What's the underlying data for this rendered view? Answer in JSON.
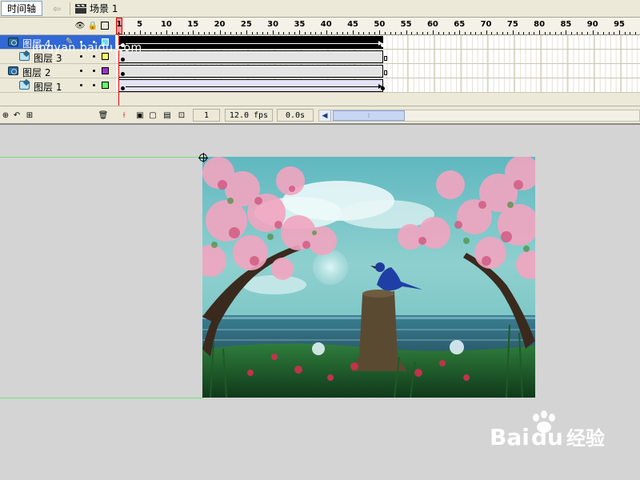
{
  "topbar": {
    "timeline_tab": "时间轴",
    "scene_label": "场景 1"
  },
  "ruler": {
    "labels": [
      "1",
      "5",
      "10",
      "15",
      "20",
      "25",
      "30",
      "35",
      "40",
      "45",
      "50",
      "55",
      "60",
      "65",
      "70",
      "75",
      "80",
      "85",
      "90",
      "95"
    ]
  },
  "layers": [
    {
      "name": "图层 4",
      "type": "mask",
      "selected": true,
      "color": "#66e0e8"
    },
    {
      "name": "图层 3",
      "type": "masked",
      "selected": false,
      "color": "#ffff66"
    },
    {
      "name": "图层 2",
      "type": "mask",
      "selected": false,
      "color": "#9933cc"
    },
    {
      "name": "图层 1",
      "type": "masked",
      "selected": false,
      "color": "#66ff66"
    }
  ],
  "status": {
    "current_frame": "1",
    "fps": "12.0 fps",
    "time": "0.0s"
  },
  "watermark": {
    "brand": "Baidu经验",
    "url": "jingyan.baidu.com"
  },
  "colors": {
    "selection": "#3168d5",
    "playhead": "#ff0000",
    "guide": "#6ee46e"
  }
}
